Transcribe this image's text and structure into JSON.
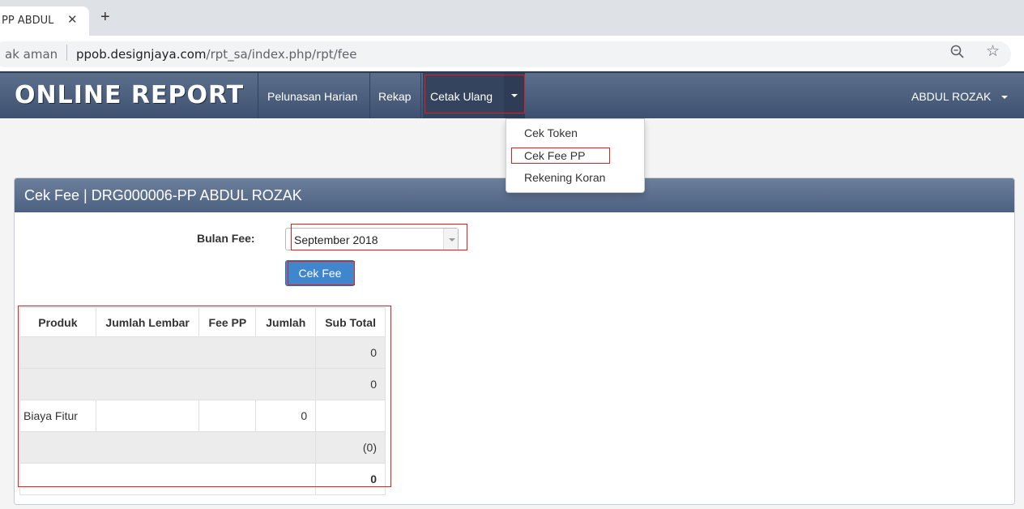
{
  "browser": {
    "tab_title": "PP ABDUL",
    "tab_close": "✕",
    "new_tab": "+",
    "secure_text": "ak aman",
    "url_host": "ppob.designjaya.com",
    "url_path": "/rpt_sa/index.php/rpt/fee",
    "star": "☆"
  },
  "navbar": {
    "brand": "ONLINE REPORT",
    "items": [
      {
        "label": "Pelunasan Harian"
      },
      {
        "label": "Rekap"
      },
      {
        "label": "Cetak Ulang"
      }
    ],
    "user": "ABDUL ROZAK"
  },
  "dropdown": {
    "items": [
      {
        "label": "Cek Token"
      },
      {
        "label": "Cek Fee PP"
      },
      {
        "label": "Rekening Koran"
      }
    ]
  },
  "panel": {
    "title": "Cek Fee | DRG000006-PP ABDUL ROZAK",
    "form": {
      "label": "Bulan Fee:",
      "selected": "September 2018",
      "button": "Cek Fee"
    }
  },
  "table": {
    "headers": [
      "Produk",
      "Jumlah Lembar",
      "Fee PP",
      "Jumlah",
      "Sub Total"
    ],
    "rows": [
      {
        "subtotal": "0"
      },
      {
        "subtotal": "0"
      },
      {
        "produk": "Biaya Fitur",
        "jumlah": "0"
      },
      {
        "subtotal": "(0)"
      },
      {
        "subtotal": "0"
      }
    ]
  },
  "colors": {
    "navbar": "#4a5c7a",
    "panel_header": "#5a6e8e",
    "button": "#3f86cc",
    "annotation": "#e02020"
  }
}
